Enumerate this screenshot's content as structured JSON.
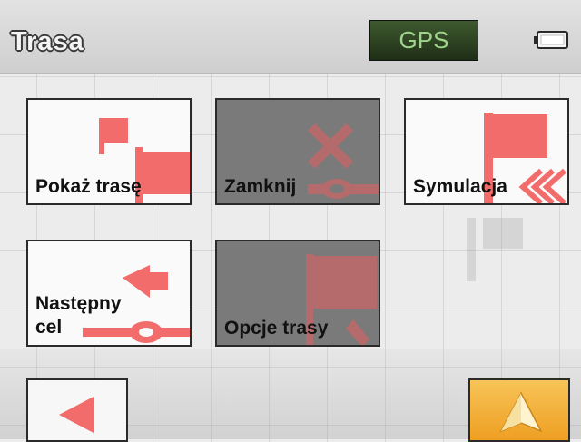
{
  "header": {
    "title": "Trasa",
    "gps_label": "GPS"
  },
  "buttons": {
    "show_route": "Pokaż trasę",
    "close": "Zamknij",
    "simulation": "Symulacja",
    "next_target_line1": "Następny",
    "next_target_line2": "cel",
    "route_options": "Opcje trasy"
  },
  "icons": {
    "battery": "battery-icon",
    "back": "back-arrow-icon",
    "navigate": "navigation-arrow-icon"
  },
  "colors": {
    "icon_accent": "#f26c6c",
    "gps_text": "#9fd58b",
    "navigate_button": "#f3b23a"
  }
}
